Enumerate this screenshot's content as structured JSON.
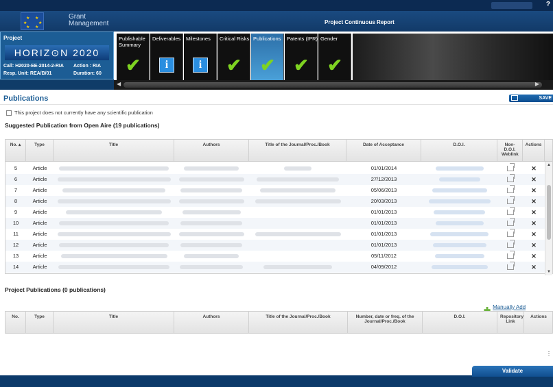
{
  "header": {
    "app_title_line1": "Grant",
    "app_title_line2": "Management",
    "report_title": "Project Continuous Report",
    "help_label": "?"
  },
  "project": {
    "label": "Project",
    "program": "HORIZ⊙N 2020",
    "call": "Call: H2020-EE-2014-2-RIA",
    "action": "Action : RIA",
    "unit": "Resp. Unit: REA/B/01",
    "duration": "Duration: 60"
  },
  "tabs": [
    {
      "label": "Publishable Summary",
      "icon": "check-icon"
    },
    {
      "label": "Deliverables",
      "icon": "info-icon"
    },
    {
      "label": "Milestones",
      "icon": "info-icon"
    },
    {
      "label": "Critical Risks",
      "icon": "check-icon"
    },
    {
      "label": "Publications",
      "icon": "check-icon",
      "active": true
    },
    {
      "label": "Patents (IPR)",
      "icon": "check-icon"
    },
    {
      "label": "Gender",
      "icon": "check-icon"
    }
  ],
  "main": {
    "section_title": "Publications",
    "save_label": "SAVE",
    "no_publication_label": "This project does not currently have any scientific publication",
    "suggested_title": "Suggested Publication from Open Aire (19 publications)",
    "project_pubs_title": "Project Publications (0 publications)",
    "add_link": "Manually Add Publication",
    "validate_label": "Validate"
  },
  "suggested_table": {
    "headers": {
      "no": "No. ▴",
      "type": "Type",
      "title": "Title",
      "authors": "Authors",
      "journal": "Title of the Journal/Proc./Book",
      "date": "Date of Acceptance",
      "doi": "D.O.I.",
      "weblink": "Non-D.O.I. Weblink",
      "actions": "Actions"
    },
    "rows": [
      {
        "no": "5",
        "type": "Article",
        "date": "01/01/2014"
      },
      {
        "no": "6",
        "type": "Article",
        "date": "27/12/2013"
      },
      {
        "no": "7",
        "type": "Article",
        "date": "05/06/2013"
      },
      {
        "no": "8",
        "type": "Article",
        "date": "20/03/2013"
      },
      {
        "no": "9",
        "type": "Article",
        "date": "01/01/2013"
      },
      {
        "no": "10",
        "type": "Article",
        "date": "01/01/2013"
      },
      {
        "no": "11",
        "type": "Article",
        "date": "01/01/2013"
      },
      {
        "no": "12",
        "type": "Article",
        "date": "01/01/2013"
      },
      {
        "no": "13",
        "type": "Article",
        "date": "05/11/2012"
      },
      {
        "no": "14",
        "type": "Article",
        "date": "04/09/2012"
      }
    ]
  },
  "project_table": {
    "headers": {
      "no": "No.",
      "type": "Type",
      "title": "Title",
      "authors": "Authors",
      "journal": "Title of the Journal/Proc./Book",
      "number": "Number, date or freq. of the Journal/Proc./Book",
      "doi": "D.O.I.",
      "repo": "Repository Link",
      "actions": "Actions"
    }
  },
  "colors": {
    "brand_blue": "#1c5d95",
    "header_navy": "#0c2a52",
    "check_green": "#7ed321"
  }
}
